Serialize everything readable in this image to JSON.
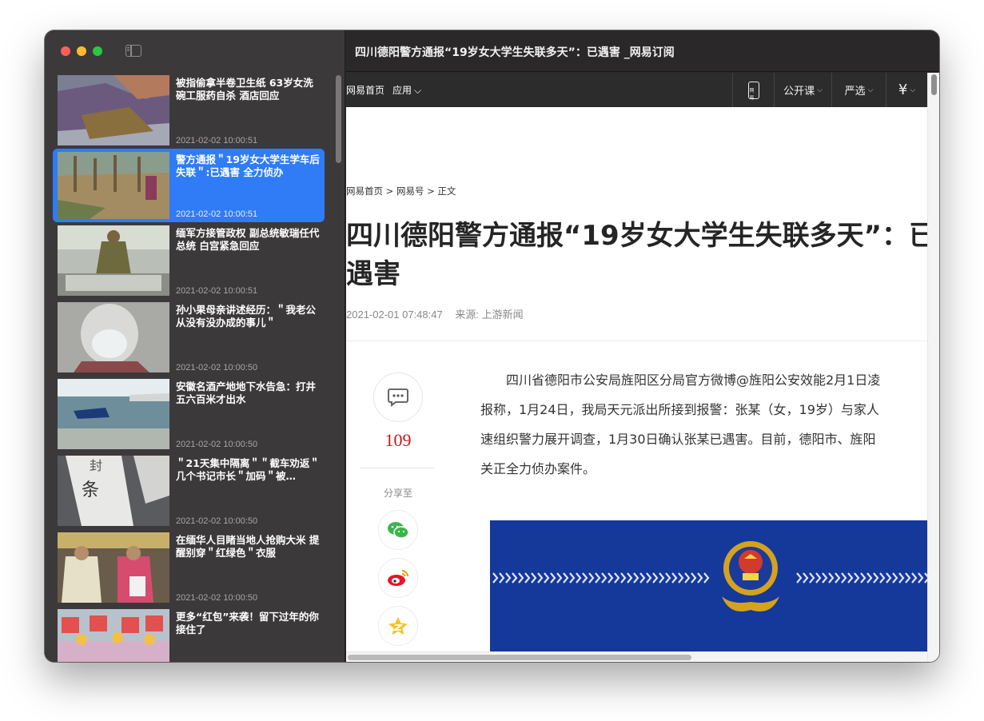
{
  "window": {
    "title": "四川德阳警方通报“19岁女大学生失联多天”：已遇害 _网易订阅"
  },
  "sidebar": {
    "items": [
      {
        "title": "被指偷拿半卷卫生纸 63岁女洗碗工服药自杀 酒店回应",
        "time": "2021-02-02 10:00:51",
        "active": false
      },
      {
        "title": "警方通报＂19岁女大学生学车后失联＂:已遇害 全力侦办",
        "time": "2021-02-02 10:00:51",
        "active": true
      },
      {
        "title": "缅军方接管政权 副总统敏瑞任代总统 白宫紧急回应",
        "time": "2021-02-02 10:00:51",
        "active": false
      },
      {
        "title": "孙小果母亲讲述经历：＂我老公从没有没办成的事儿＂",
        "time": "2021-02-02 10:00:50",
        "active": false
      },
      {
        "title": "安徽名酒产地地下水告急：打井五六百米才出水",
        "time": "2021-02-02 10:00:50",
        "active": false
      },
      {
        "title": "＂21天集中隔离＂＂截车劝返＂几个书记市长＂加码＂被…",
        "time": "2021-02-02 10:00:50",
        "active": false
      },
      {
        "title": "在缅华人目睹当地人抢购大米 提醒别穿＂红绿色＂衣服",
        "time": "2021-02-02 10:00:50",
        "active": false
      },
      {
        "title": "更多“红包”来袭！留下过年的你接住了",
        "time": "",
        "active": false
      }
    ]
  },
  "nav": {
    "home": "网易首页",
    "apps": "应用",
    "open_course": "公开课",
    "yanxuan": "严选",
    "yen": "¥"
  },
  "article": {
    "breadcrumb": "网易首页 > 网易号 > 正文",
    "headline": "四川德阳警方通报“19岁女大学生失联多天”：已遇害",
    "date": "2021-02-01 07:48:47",
    "source": "来源: 上游新闻",
    "comment_count": "109",
    "share_label": "分享至",
    "paragraphs": [
      "　　四川省德阳市公安局旌阳区分局官方微博@旌阳公安效能2月1日凌",
      "报称，1月24日，我局天元派出所接到报警：张某（女，19岁）与家人",
      "速组织警力展开调查，1月30日确认张某已遇害。目前，德阳市、旌阳",
      "关正全力侦办案件。"
    ]
  },
  "colors": {
    "accent": "#2f7cf6",
    "comment_red": "#c8161d"
  }
}
